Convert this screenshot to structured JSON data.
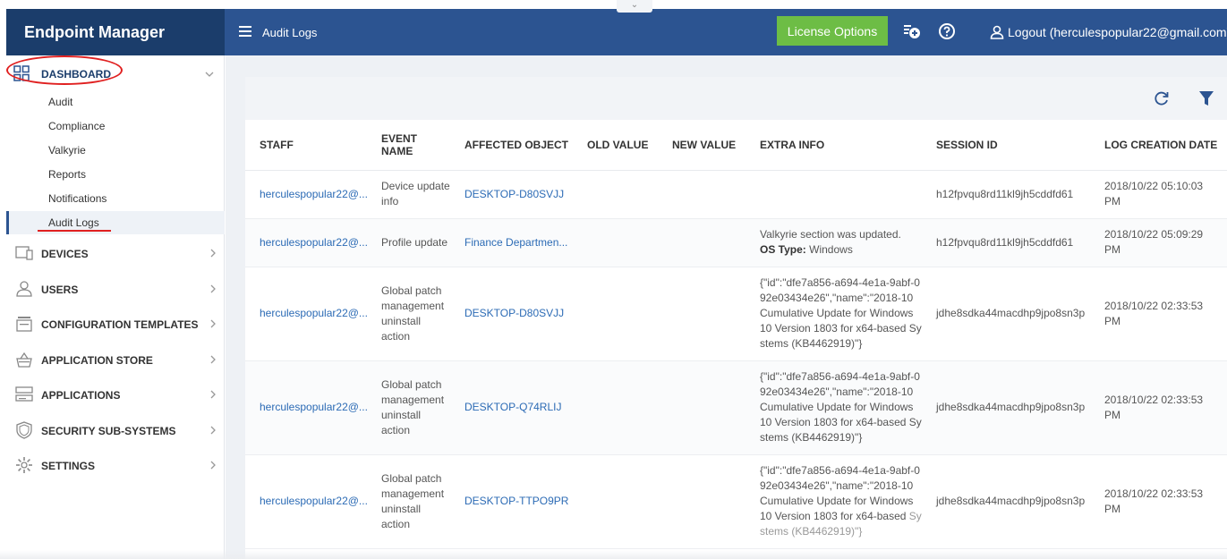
{
  "header": {
    "brand": "Endpoint Manager",
    "title": "Audit Logs",
    "collapse_glyph": "⌄",
    "license_button": "License Options",
    "logout_label": "Logout (herculespopular22@gmail.com)"
  },
  "sidebar": {
    "dashboard_label": "DASHBOARD",
    "dashboard_items": [
      "Audit",
      "Compliance",
      "Valkyrie",
      "Reports",
      "Notifications",
      "Audit Logs"
    ],
    "nav": [
      {
        "label": "DEVICES",
        "icon": "devices-icon"
      },
      {
        "label": "USERS",
        "icon": "user-icon"
      },
      {
        "label": "CONFIGURATION TEMPLATES",
        "icon": "template-icon"
      },
      {
        "label": "APPLICATION STORE",
        "icon": "basket-icon"
      },
      {
        "label": "APPLICATIONS",
        "icon": "applications-icon"
      },
      {
        "label": "SECURITY SUB-SYSTEMS",
        "icon": "shield-icon"
      },
      {
        "label": "SETTINGS",
        "icon": "gear-icon"
      }
    ]
  },
  "table": {
    "columns": [
      "STAFF",
      "EVENT NAME",
      "AFFECTED OBJECT",
      "OLD VALUE",
      "NEW VALUE",
      "EXTRA INFO",
      "SESSION ID",
      "LOG CREATION DATE"
    ],
    "rows": [
      {
        "staff": "herculespopular22@...",
        "event": "Device update info",
        "object": "DESKTOP-D80SVJJ",
        "old": "",
        "new": "",
        "extra": "",
        "extra_label": "",
        "extra_value": "",
        "session": "h12fpvqu8rd11kl9jh5cddfd61",
        "date": "2018/10/22 05:10:03 PM"
      },
      {
        "staff": "herculespopular22@...",
        "event": "Profile update",
        "object": "Finance Departmen...",
        "old": "",
        "new": "",
        "extra": "Valkyrie section was updated.",
        "extra_label": "OS Type:",
        "extra_value": "Windows",
        "session": "h12fpvqu8rd11kl9jh5cddfd61",
        "date": "2018/10/22 05:09:29 PM"
      },
      {
        "staff": "herculespopular22@...",
        "event": "Global patch management uninstall action",
        "object": "DESKTOP-D80SVJJ",
        "old": "",
        "new": "",
        "extra": "{\"id\":\"dfe7a856-a694-4e1a-9abf-092e03434e26\",\"name\":\"2018-10 Cumulative Update for Windows 10 Version 1803 for x64-based Systems (KB4462919)\"}",
        "extra_label": "",
        "extra_value": "",
        "session": "jdhe8sdka44macdhp9jpo8sn3p",
        "date": "2018/10/22 02:33:53 PM"
      },
      {
        "staff": "herculespopular22@...",
        "event": "Global patch management uninstall action",
        "object": "DESKTOP-Q74RLIJ",
        "old": "",
        "new": "",
        "extra": "{\"id\":\"dfe7a856-a694-4e1a-9abf-092e03434e26\",\"name\":\"2018-10 Cumulative Update for Windows 10 Version 1803 for x64-based Systems (KB4462919)\"}",
        "extra_label": "",
        "extra_value": "",
        "session": "jdhe8sdka44macdhp9jpo8sn3p",
        "date": "2018/10/22 02:33:53 PM"
      },
      {
        "staff": "herculespopular22@...",
        "event": "Global patch management uninstall action",
        "object": "DESKTOP-TTPO9PR",
        "old": "",
        "new": "",
        "extra": "{\"id\":\"dfe7a856-a694-4e1a-9abf-092e03434e26\",\"name\":\"2018-10 Cumulative Update for Windows 10 Version 1803 for x64-based",
        "extra_faded": "Systems (KB4462919)\"}",
        "extra_label": "",
        "extra_value": "",
        "session": "jdhe8sdka44macdhp9jpo8sn3p",
        "date": "2018/10/22 02:33:53 PM"
      }
    ]
  },
  "toolbar": {
    "icons": [
      "refresh-icon",
      "filter-icon"
    ]
  },
  "colors": {
    "brand_bg": "#1b3d6b",
    "header_bg": "#2c5491",
    "license_green": "#6dbd45",
    "link_blue": "#2c6bb5",
    "annotation_red": "#e02020"
  }
}
